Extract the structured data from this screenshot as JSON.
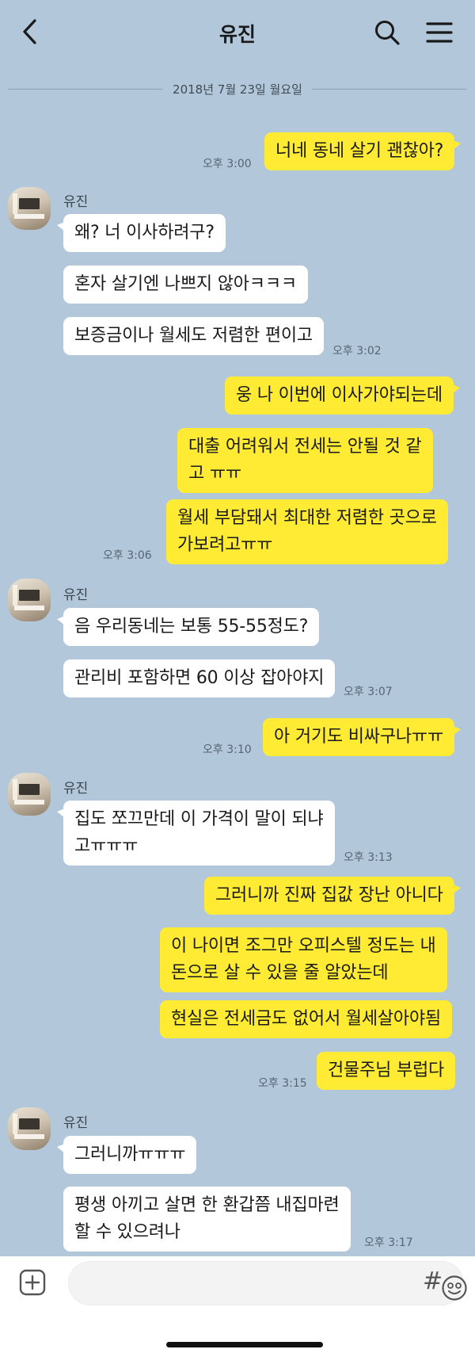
{
  "header": {
    "title": "유진",
    "back_icon": "chevron-left-icon",
    "search_icon": "search-icon",
    "menu_icon": "hamburger-menu-icon"
  },
  "date_divider": "2018년 7월 23일 월요일",
  "contact_name": "유진",
  "messages": {
    "m1": "너네 동네 살기 괜찮아?",
    "t1": "오후 3:00",
    "m2": "왜? 너 이사하려구?",
    "m3": "혼자 살기엔 나쁘지 않아ㅋㅋㅋ",
    "m4": "보증금이나 월세도 저렴한 편이고",
    "t2": "오후 3:02",
    "m5": "웅 나 이번에 이사가야되는데",
    "m6": "대출 어려워서 전세는 안될 것 같\n고 ㅠㅠ",
    "m7": "월세 부담돼서 최대한 저렴한 곳으로\n가보려고ㅠㅠ",
    "t3": "오후 3:06",
    "m8": "음 우리동네는 보통 55-55정도?",
    "m9": "관리비 포함하면 60 이상 잡아야지",
    "t4": "오후 3:07",
    "m10": "아 거기도 비싸구나ㅠㅠ",
    "t5": "오후 3:10",
    "m11": "집도 쪼끄만데 이 가격이 말이 되냐\n고ㅠㅠㅠ",
    "t6": "오후 3:13",
    "m12": "그러니까 진짜 집값 장난 아니다",
    "m13": "이 나이면 조그만 오피스텔 정도는 내\n돈으로 살 수 있을 줄 알았는데",
    "m14": "현실은 전세금도 없어서 월세살아야됨",
    "m15": "건물주님 부럽다",
    "t7": "오후 3:15",
    "m16": "그러니까ㅠㅠㅠ",
    "m17": "평생 아끼고 살면 한 환갑쯤 내집마련\n할 수 있으려나",
    "t8": "오후 3:17"
  },
  "footer": {
    "plus_icon": "plus-square-icon",
    "emoji_icon": "emoji-icon",
    "hash_label": "#"
  },
  "colors": {
    "background": "#b2c7d9",
    "my_bubble": "#ffeb33",
    "their_bubble": "#ffffff"
  }
}
